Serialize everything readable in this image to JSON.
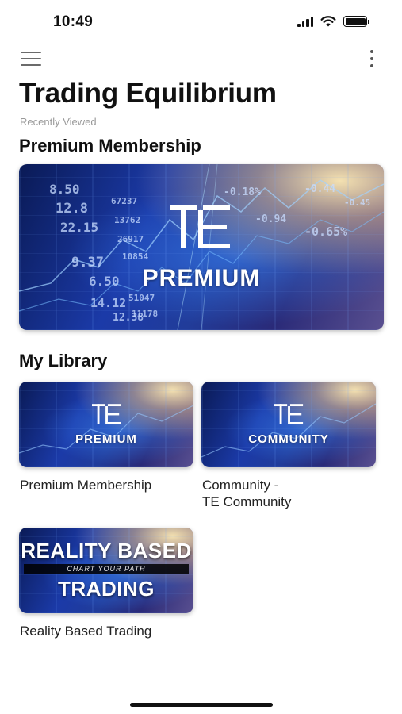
{
  "status_bar": {
    "time": "10:49"
  },
  "header": {
    "menu_icon": "hamburger-menu-icon",
    "more_icon": "vertical-more-icon",
    "title": "Trading Equilibrium",
    "subtitle": "Recently Viewed"
  },
  "recent": {
    "section_title": "Premium Membership",
    "card": {
      "logo": "TE",
      "caption": "PREMIUM"
    },
    "numbers": [
      "8.50",
      "12.8",
      "22.15",
      "9.37",
      "6.50",
      "14.12",
      "12.38",
      "-0.18%",
      "-0.44",
      "-0.94",
      "-0.65%",
      "67237",
      "13762",
      "26917",
      "10854",
      "51047",
      "11178",
      "-0.45"
    ]
  },
  "library": {
    "section_title": "My Library",
    "items": [
      {
        "logo": "TE",
        "caption": "PREMIUM",
        "label": "Premium Membership"
      },
      {
        "logo": "TE",
        "caption": "COMMUNITY",
        "label_line1": "Community -",
        "label_line2": "TE Community"
      },
      {
        "title_line1": "REALITY BASED",
        "tagline": "CHART YOUR PATH",
        "title_line2": "TRADING",
        "label": "Reality Based Trading"
      }
    ]
  },
  "colors": {
    "accent_blue": "#1b3aa8",
    "text": "#111111",
    "muted": "#9a9a9a"
  }
}
